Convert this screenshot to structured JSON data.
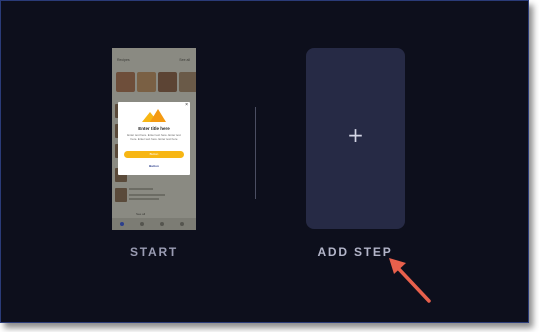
{
  "start_label": "START",
  "add_step_label": "ADD STEP",
  "add_icon": "+",
  "preview": {
    "app_title": "Recipes",
    "app_link": "See all",
    "modal": {
      "title": "Enter title here",
      "body": "Enter text here. Enter text here. Enter text here. Enter text here. Enter text here",
      "button_label": "Button",
      "link_label": "Button",
      "close": "×"
    },
    "more_label": "See all"
  },
  "colors": {
    "background": "#0d0f1c",
    "card": "#262a45",
    "accent": "#f7b614",
    "arrow": "#e8604c",
    "label": "#9a9cb3"
  }
}
